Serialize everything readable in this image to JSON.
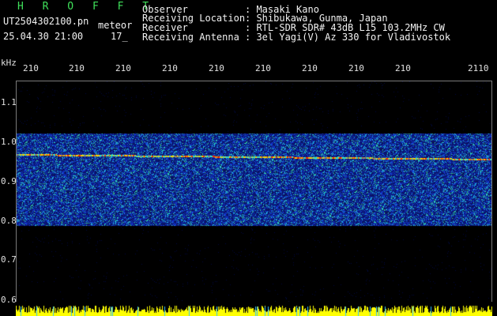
{
  "header": {
    "title": "H R O F F T",
    "filename": "UT2504302100.pn",
    "type_label": "meteor",
    "datetime": "25.04.30 21:00",
    "minute": "17_",
    "info": [
      {
        "key": "Observer",
        "value": ": Masaki Kano"
      },
      {
        "key": "Receiving Location",
        "value": ": Shibukawa, Gunma, Japan"
      },
      {
        "key": "Receiver",
        "value": ": RTL-SDR SDR# 43dB L15 103.2MHz CW"
      },
      {
        "key": "Receiving Antenna",
        "value": ": 3el Yagi(V) Az 330 for Vladivostok"
      }
    ]
  },
  "axes": {
    "y_unit": "kHz",
    "y_ticks": [
      "1.1",
      "1.0",
      "0.9",
      "0.8",
      "0.7",
      "0.6"
    ],
    "x_ticks": [
      "210",
      "210",
      "210",
      "210",
      "210",
      "210",
      "210",
      "210",
      "210",
      "2110"
    ]
  },
  "colors": {
    "text_green": "#3fe05a",
    "text_white": "#f2f2f2",
    "echo_red": "#ff2a00",
    "noise_blue": "#1c3aa8",
    "strip_yellow": "#ffff00"
  }
}
